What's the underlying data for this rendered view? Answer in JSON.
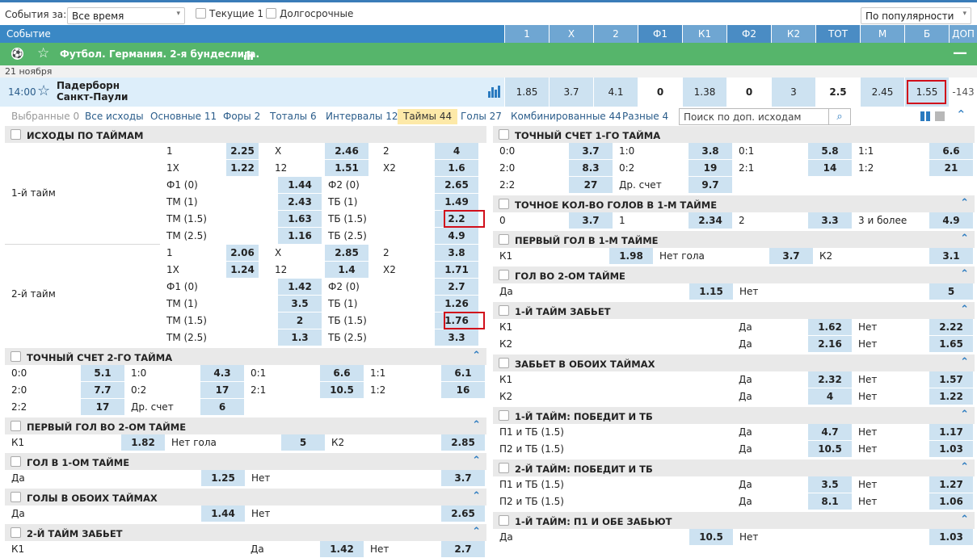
{
  "filter": {
    "events_for_label": "События за:",
    "period_value": "Все время",
    "current_label": "Текущие 1",
    "longterm_label": "Долгосрочные",
    "sort_value": "По популярности"
  },
  "header": {
    "event_label": "Событие",
    "cols": [
      "1",
      "X",
      "2",
      "Ф1",
      "К1",
      "Ф2",
      "К2",
      "ТОТ",
      "М",
      "Б",
      "ДОП"
    ]
  },
  "league": {
    "name": "Футбол. Германия. 2-я бундеслига.",
    "collapse": "—"
  },
  "date": "21 ноября",
  "match": {
    "time": "14:00",
    "team1": "Падерборн",
    "team2": "Санкт-Паули",
    "odds": [
      "1.85",
      "3.7",
      "4.1",
      "0",
      "1.38",
      "0",
      "3",
      "2.5",
      "2.45",
      "1.55"
    ],
    "extra": "-143"
  },
  "tabs": [
    "Выбранные 0",
    "Все исходы",
    "Основные 11",
    "Форы 2",
    "Тоталы 6",
    "Интервалы 12",
    "Таймы 44",
    "Голы 27",
    "Комбинированные 44",
    "Разные 4"
  ],
  "search_placeholder": "Поиск по доп. исходам",
  "halves": {
    "title": "ИСХОДЫ ПО ТАЙМАМ",
    "first_label": "1-й тайм",
    "second_label": "2-й тайм",
    "first": {
      "r1": [
        "1",
        "2.25",
        "X",
        "2.46",
        "2",
        "4"
      ],
      "r2": [
        "1X",
        "1.22",
        "12",
        "1.51",
        "X2",
        "1.6"
      ],
      "r3": [
        "Ф1 (0)",
        "1.44",
        "Ф2 (0)",
        "2.65"
      ],
      "r4": [
        "ТМ (1)",
        "2.43",
        "ТБ (1)",
        "1.49"
      ],
      "r5": [
        "ТМ (1.5)",
        "1.63",
        "ТБ (1.5)",
        "2.2"
      ],
      "r6": [
        "ТМ (2.5)",
        "1.16",
        "ТБ (2.5)",
        "4.9"
      ]
    },
    "second": {
      "r1": [
        "1",
        "2.06",
        "X",
        "2.85",
        "2",
        "3.8"
      ],
      "r2": [
        "1X",
        "1.24",
        "12",
        "1.4",
        "X2",
        "1.71"
      ],
      "r3": [
        "Ф1 (0)",
        "1.42",
        "Ф2 (0)",
        "2.7"
      ],
      "r4": [
        "ТМ (1)",
        "3.5",
        "ТБ (1)",
        "1.26"
      ],
      "r5": [
        "ТМ (1.5)",
        "2",
        "ТБ (1.5)",
        "1.76"
      ],
      "r6": [
        "ТМ (2.5)",
        "1.3",
        "ТБ (2.5)",
        "3.3"
      ]
    }
  },
  "exact2": {
    "title": "ТОЧНЫЙ СЧЕТ 2-ГО ТАЙМА",
    "r1": [
      "0:0",
      "5.1",
      "1:0",
      "4.3",
      "0:1",
      "6.6",
      "1:1",
      "6.1"
    ],
    "r2": [
      "2:0",
      "7.7",
      "0:2",
      "17",
      "2:1",
      "10.5",
      "1:2",
      "16"
    ],
    "r3": [
      "2:2",
      "17",
      "Др. счет",
      "6"
    ]
  },
  "firstgoal2": {
    "title": "ПЕРВЫЙ ГОЛ ВО 2-ОМ ТАЙМЕ",
    "r1": [
      "К1",
      "1.82",
      "Нет гола",
      "5",
      "К2",
      "2.85"
    ]
  },
  "goal1": {
    "title": "ГОЛ В 1-ОМ ТАЙМЕ",
    "r1": [
      "Да",
      "1.25",
      "Нет",
      "3.7"
    ]
  },
  "goalsboth": {
    "title": "ГОЛЫ В ОБОИХ ТАЙМАХ",
    "r1": [
      "Да",
      "1.44",
      "Нет",
      "2.65"
    ]
  },
  "half2score": {
    "title": "2-Й ТАЙМ ЗАБЬЕТ",
    "r1": [
      "К1",
      "Да",
      "1.42",
      "Нет",
      "2.7"
    ]
  },
  "exact1": {
    "title": "ТОЧНЫЙ СЧЕТ 1-ГО ТАЙМА",
    "r1": [
      "0:0",
      "3.7",
      "1:0",
      "3.8",
      "0:1",
      "5.8",
      "1:1",
      "6.6"
    ],
    "r2": [
      "2:0",
      "8.3",
      "0:2",
      "19",
      "2:1",
      "14",
      "1:2",
      "21"
    ],
    "r3": [
      "2:2",
      "27",
      "Др. счет",
      "9.7"
    ]
  },
  "goalsnum1": {
    "title": "ТОЧНОЕ КОЛ-ВО ГОЛОВ В 1-М ТАЙМЕ",
    "r1": [
      "0",
      "3.7",
      "1",
      "2.34",
      "2",
      "3.3",
      "3 и более",
      "4.9"
    ]
  },
  "firstgoal1": {
    "title": "ПЕРВЫЙ ГОЛ В 1-М ТАЙМЕ",
    "r1": [
      "К1",
      "1.98",
      "Нет гола",
      "3.7",
      "К2",
      "3.1"
    ]
  },
  "goal2": {
    "title": "ГОЛ ВО 2-ОМ ТАЙМЕ",
    "r1": [
      "Да",
      "1.15",
      "Нет",
      "5"
    ]
  },
  "half1score": {
    "title": "1-Й ТАЙМ ЗАБЬЕТ",
    "r1": [
      "К1",
      "Да",
      "1.62",
      "Нет",
      "2.22"
    ],
    "r2": [
      "К2",
      "Да",
      "2.16",
      "Нет",
      "1.65"
    ]
  },
  "scoreboth": {
    "title": "ЗАБЬЕТ В ОБОИХ ТАЙМАХ",
    "r1": [
      "К1",
      "Да",
      "2.32",
      "Нет",
      "1.57"
    ],
    "r2": [
      "К2",
      "Да",
      "4",
      "Нет",
      "1.22"
    ]
  },
  "h1winTB": {
    "title": "1-Й ТАЙМ: ПОБЕДИТ И ТБ",
    "r1": [
      "П1 и ТБ (1.5)",
      "Да",
      "4.7",
      "Нет",
      "1.17"
    ],
    "r2": [
      "П2 и ТБ (1.5)",
      "Да",
      "10.5",
      "Нет",
      "1.03"
    ]
  },
  "h2winTB": {
    "title": "2-Й ТАЙМ: ПОБЕДИТ И ТБ",
    "r1": [
      "П1 и ТБ (1.5)",
      "Да",
      "3.5",
      "Нет",
      "1.27"
    ],
    "r2": [
      "П2 и ТБ (1.5)",
      "Да",
      "8.1",
      "Нет",
      "1.06"
    ]
  },
  "h1p1both": {
    "title": "1-Й ТАЙМ: П1 И ОБЕ ЗАБЬЮТ",
    "r1": [
      "Да",
      "10.5",
      "Нет",
      "1.03"
    ]
  }
}
